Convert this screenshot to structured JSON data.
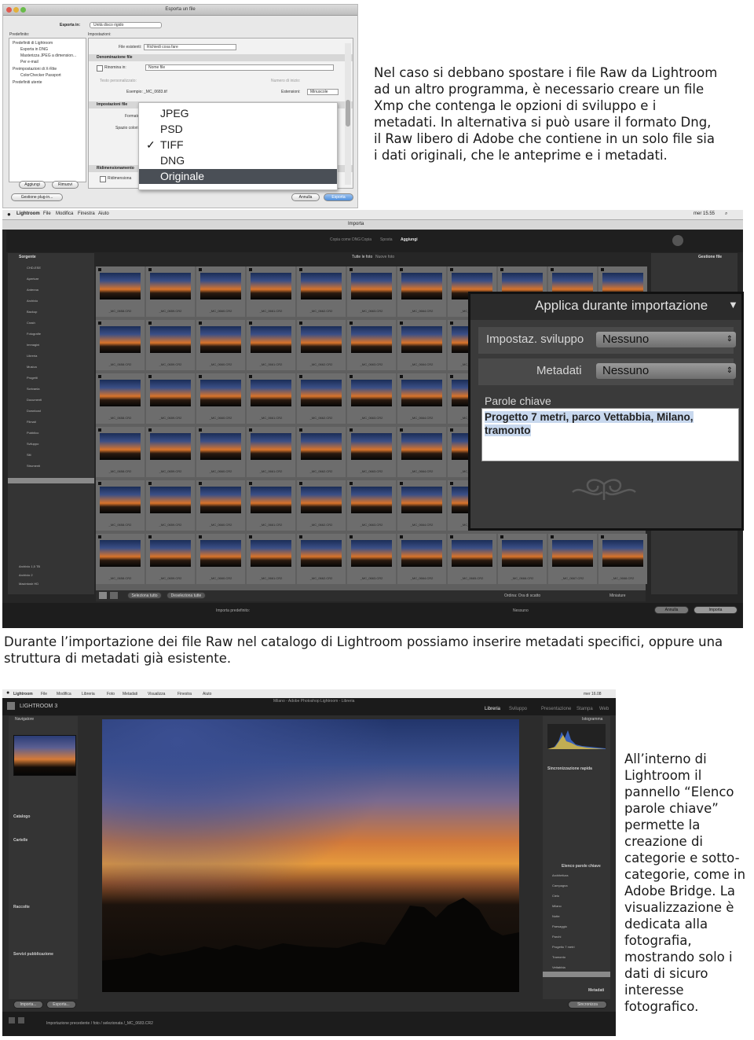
{
  "captions": {
    "top_right": "Nel caso si debbano spostare i file Raw da Lightroom ad un altro programma, è necessario creare un file Xmp che contenga le opzioni di sviluppo e i metadati. In alternativa si può usare il formato Dng, il Raw libero di Adobe che contiene in un solo file sia i dati originali, che le anteprime e i metadati.",
    "middle": "Durante l’importazione dei file Raw nel catalogo di Lightroom possiamo inserire metadati specifici, oppure una struttura di metadati già esistente.",
    "bottom_right": "All’interno di Lightroom il pannello “Elenco parole chiave” permette la creazione di categorie e sotto-categorie, come in Adobe Bridge. La visualizzazione è dedicata alla fotografia, mostrando solo i dati di sicuro interesse fotografico."
  },
  "export_dialog": {
    "title": "Esporta un file",
    "export_to_label": "Esporta in:",
    "export_to_value": "Unità disco rigido",
    "presets_header": "Predefinito:",
    "presets": [
      "Predefiniti di Lightroom",
      "Esporta in DNG",
      "Masterizza JPEG a dimension...",
      "Per e-mail",
      "Preimpostazioni di X-Rite",
      "ColorChecker Passport",
      "Predefiniti utente"
    ],
    "settings_header": "Impostazioni:",
    "existing_files_label": "File esistenti:",
    "existing_files_value": "Richiedi cosa fare",
    "naming_section": "Denominazione file",
    "rename_to_label": "Rinomina in:",
    "rename_to_value": "Nome file",
    "custom_text_label": "Testo personalizzato:",
    "start_number_label": "Numero di inizio:",
    "example_label": "Esempio:",
    "example_value": "_MC_0683.tif",
    "extensions_label": "Estensioni:",
    "extensions_value": "Minuscole",
    "file_settings_section": "Impostazioni file",
    "format_label": "Formato",
    "color_space_label": "Spazio colori",
    "resize_section": "Ridimensionamento",
    "resize_checkbox": "Ridimensiona",
    "format_options": [
      "JPEG",
      "PSD",
      "TIFF",
      "DNG",
      "Originale"
    ],
    "format_checked": "TIFF",
    "format_highlighted": "Originale",
    "add_button": "Aggiungi",
    "remove_button": "Rimuovi",
    "plugin_button": "Gestione plug-in...",
    "cancel_button": "Annulla",
    "export_button": "Esporta"
  },
  "import_window": {
    "menu": [
      "Lightroom",
      "File",
      "Modifica",
      "Finestra",
      "Aiuto"
    ],
    "clock": "mer 15.55",
    "window_title": "Importa",
    "modes": [
      "Copia come DNG",
      "Copia",
      "Sposta",
      "Aggiungi"
    ],
    "active_mode": "Aggiungi",
    "source_header": "Sorgente",
    "grid_tabs": [
      "Tutte le foto",
      "Nuove foto"
    ],
    "folders": [
      "CHD-ESE",
      "Aperture",
      "Antenna",
      "Archivio",
      "Backup",
      "Crash",
      "Fotografie",
      "Immagini",
      "Libreria",
      "Musica",
      "Progetti",
      "Scrivania",
      "Documenti",
      "Download",
      "Filmati",
      "Pubblico",
      "Sviluppo",
      "Siti",
      "Strumenti"
    ],
    "volumes": [
      "Archivio 1,5 TB",
      "Archivio 2",
      "Macintosh HD"
    ],
    "select_all_button": "Seleziona tutto",
    "deselect_all_button": "Deseleziona tutte",
    "sort_label": "Ordina: Ora di scatto",
    "thumb_label": "Miniature",
    "import_button": "Importa",
    "cancel_button": "Annulla",
    "footer_left": "Importa predefinito:",
    "footer_value": "Nessuno",
    "right_panel_header": "Gestione file",
    "apply_panel": {
      "title": "Applica durante importazione",
      "develop_label": "Impostaz. sviluppo",
      "develop_value": "Nessuno",
      "metadata_label": "Metadati",
      "metadata_value": "Nessuno",
      "keywords_label": "Parole chiave",
      "keywords_value": "Progetto 7 metri, parco Vettabbia, Milano, tramonto"
    },
    "thumb_filenames": [
      "_MC_0658.CR2",
      "_MC_0659.CR2",
      "_MC_0660.CR2",
      "_MC_0661.CR2",
      "_MC_0662.CR2",
      "_MC_0663.CR2",
      "_MC_0664.CR2",
      "_MC_0665.CR2",
      "_MC_0666.CR2",
      "_MC_0667.CR2",
      "_MC_0668.CR2"
    ]
  },
  "library_window": {
    "menu": [
      "Lightroom",
      "File",
      "Modifica",
      "Libreria",
      "Foto",
      "Metadati",
      "Visualizza",
      "Finestra",
      "Aiuto"
    ],
    "clock": "mer 16.08",
    "brand": "LIGHTROOM 3",
    "window_title": "Milano - Adobe Photoshop Lightroom - Libreria",
    "modules": [
      "Libreria",
      "Sviluppo",
      "Presentazione",
      "Stampa",
      "Web"
    ],
    "active_module": "Libreria",
    "navigator": "Navigatore",
    "left_sections": [
      "Catalogo",
      "Cartelle",
      "Raccolte",
      "Servizi pubblicazione"
    ],
    "right_sections": [
      "Istogramma",
      "Sincronizzazione rapida",
      "Elenco parole chiave",
      "Metadati"
    ],
    "keywords": [
      "Architettura",
      "Campagna",
      "Cielo",
      "Milano",
      "Notte",
      "Paesaggio",
      "Parchi",
      "Progetto 7 metri",
      "Tramonto",
      "Vettabbia"
    ],
    "import_button": "Importa...",
    "export_button": "Esporta...",
    "sync_button": "Sincronizza",
    "footer_path": "Importazione precedente / foto / selezionata /_MC_0683.CR2"
  },
  "colors": {
    "caption_text": "#1a1a1a",
    "lightroom_dark": "#262626",
    "selection_dark": "#4a4f56",
    "keyword_highlight": "#c8d8ee"
  }
}
